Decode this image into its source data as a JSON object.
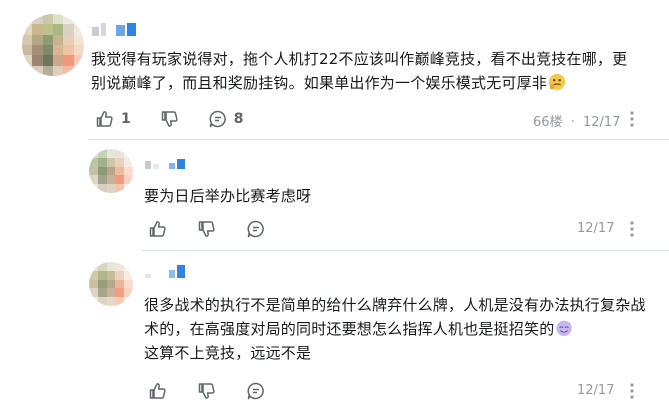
{
  "comments": [
    {
      "text": "我觉得有玩家说得对，拖个人机打22不应该叫作巅峰竞技，看不出竞技在哪，更别说巅峰了，而且和奖励挂钩。如果单出作为一个娱乐模式无可厚非",
      "emoji_icon": "thinking-face-emoji",
      "like_count": "1",
      "reply_count": "8",
      "floor": "66楼",
      "sep": "·",
      "date": "12/17"
    }
  ],
  "replies": [
    {
      "text": "要为日后举办比赛考虑呀",
      "date": "12/17"
    },
    {
      "text": "很多战术的执行不是简单的给什么牌弃什么牌，人机是没有办法执行复杂战术的，在高强度对局的同时还要想怎么指挥人机也是挺招笑的",
      "emoji_icon": "sweat-smile-emoji",
      "text_tail": "这算不上竞技，远远不是",
      "date": "12/17"
    }
  ],
  "icons": {
    "like": "thumbs-up-icon",
    "dislike": "thumbs-down-icon",
    "reply": "comment-bubble-icon",
    "more": "more-vertical-icon"
  },
  "colors": {
    "text": "#18191c",
    "muted": "#9499a0",
    "action": "#61666d",
    "divider": "#e3e5e7"
  }
}
